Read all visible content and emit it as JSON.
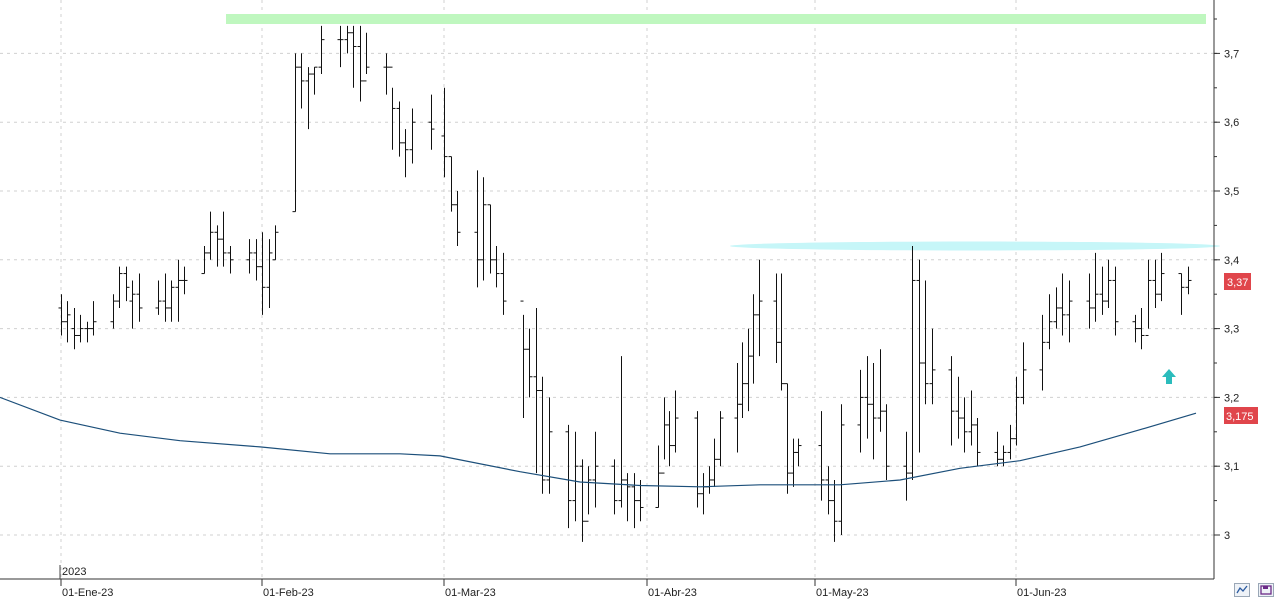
{
  "chart_data": {
    "type": "ohlc-bar",
    "year_label": "2023",
    "x_tick_labels": [
      "01-Ene-23",
      "01-Feb-23",
      "01-Mar-23",
      "01-Abr-23",
      "01-May-23",
      "01-Jun-23"
    ],
    "y_tick_labels": [
      "3,7",
      "3,6",
      "3,5",
      "3,4",
      "3,3",
      "3,2",
      "3,1",
      "3"
    ],
    "y_ticks": [
      3.7,
      3.6,
      3.5,
      3.4,
      3.3,
      3.2,
      3.1,
      3.0
    ],
    "ylim": [
      2.98,
      3.78
    ],
    "grid": true,
    "price_badge": {
      "label": "3,37",
      "value": 3.37,
      "color": "#e0454b"
    },
    "ma_badge": {
      "label": "3,175",
      "value": 3.175,
      "color": "#e0454b"
    },
    "ma_color": "#1c4f7a",
    "resistance_top": {
      "value": 3.745,
      "from": "2023-01-26",
      "to": "2023-06-30",
      "color": "#bff7bf"
    },
    "resistance_mid": {
      "value": 3.418,
      "from": "2023-04-04",
      "to": "2023-06-28",
      "color": "#c6f6f8"
    },
    "arrow_color": "#2bbcbc",
    "arrow_value": 3.235,
    "arrow_date": "2023-06-26",
    "series": [
      {
        "type": "ohlc",
        "points": [
          [
            "2023-01-01",
            3.33,
            3.35,
            3.29,
            3.31
          ],
          [
            "2023-01-02",
            3.31,
            3.34,
            3.28,
            3.32
          ],
          [
            "2023-01-03",
            3.3,
            3.33,
            3.27,
            3.29
          ],
          [
            "2023-01-04",
            3.29,
            3.32,
            3.28,
            3.3
          ],
          [
            "2023-01-05",
            3.3,
            3.31,
            3.28,
            3.3
          ],
          [
            "2023-01-06",
            3.3,
            3.34,
            3.29,
            3.31
          ],
          [
            "2023-01-09",
            3.31,
            3.35,
            3.3,
            3.34
          ],
          [
            "2023-01-10",
            3.34,
            3.39,
            3.33,
            3.38
          ],
          [
            "2023-01-11",
            3.38,
            3.39,
            3.34,
            3.36
          ],
          [
            "2023-01-12",
            3.34,
            3.37,
            3.3,
            3.35
          ],
          [
            "2023-01-13",
            3.35,
            3.38,
            3.31,
            3.33
          ],
          [
            "2023-01-16",
            3.33,
            3.37,
            3.32,
            3.34
          ],
          [
            "2023-01-17",
            3.34,
            3.38,
            3.31,
            3.33
          ],
          [
            "2023-01-18",
            3.33,
            3.37,
            3.31,
            3.36
          ],
          [
            "2023-01-19",
            3.36,
            3.4,
            3.31,
            3.37
          ],
          [
            "2023-01-20",
            3.37,
            3.39,
            3.35,
            3.37
          ],
          [
            "2023-01-23",
            3.38,
            3.42,
            3.38,
            3.41
          ],
          [
            "2023-01-24",
            3.41,
            3.47,
            3.4,
            3.44
          ],
          [
            "2023-01-25",
            3.44,
            3.45,
            3.39,
            3.43
          ],
          [
            "2023-01-26",
            3.43,
            3.47,
            3.39,
            3.41
          ],
          [
            "2023-01-27",
            3.41,
            3.42,
            3.38,
            3.4
          ],
          [
            "2023-01-30",
            3.4,
            3.43,
            3.38,
            3.41
          ],
          [
            "2023-01-31",
            3.41,
            3.43,
            3.37,
            3.39
          ],
          [
            "2023-02-01",
            3.39,
            3.44,
            3.32,
            3.36
          ],
          [
            "2023-02-02",
            3.36,
            3.43,
            3.33,
            3.41
          ],
          [
            "2023-02-03",
            3.4,
            3.45,
            3.4,
            3.44
          ],
          [
            "2023-02-06",
            3.47,
            3.7,
            3.47,
            3.68
          ],
          [
            "2023-02-07",
            3.68,
            3.7,
            3.62,
            3.66
          ],
          [
            "2023-02-08",
            3.66,
            3.68,
            3.59,
            3.67
          ],
          [
            "2023-02-09",
            3.67,
            3.68,
            3.64,
            3.68
          ],
          [
            "2023-02-10",
            3.68,
            3.74,
            3.67,
            3.72
          ],
          [
            "2023-02-13",
            3.72,
            3.74,
            3.68,
            3.72
          ],
          [
            "2023-02-14",
            3.72,
            3.74,
            3.7,
            3.73
          ],
          [
            "2023-02-15",
            3.73,
            3.74,
            3.65,
            3.71
          ],
          [
            "2023-02-16",
            3.71,
            3.74,
            3.63,
            3.66
          ],
          [
            "2023-02-17",
            3.66,
            3.73,
            3.67,
            3.68
          ],
          [
            "2023-02-20",
            3.68,
            3.7,
            3.64,
            3.68
          ],
          [
            "2023-02-21",
            3.68,
            3.65,
            3.56,
            3.62
          ],
          [
            "2023-02-22",
            3.62,
            3.63,
            3.55,
            3.57
          ],
          [
            "2023-02-23",
            3.57,
            3.59,
            3.52,
            3.56
          ],
          [
            "2023-02-24",
            3.56,
            3.62,
            3.54,
            3.6
          ],
          [
            "2023-02-27",
            3.6,
            3.64,
            3.56,
            3.59
          ]
        ]
      }
    ],
    "ma_points": [
      [
        0,
        3.2
      ],
      [
        60,
        3.167
      ],
      [
        120,
        3.148
      ],
      [
        180,
        3.137
      ],
      [
        260,
        3.128
      ],
      [
        330,
        3.118
      ],
      [
        400,
        3.118
      ],
      [
        440,
        3.115
      ],
      [
        520,
        3.092
      ],
      [
        580,
        3.077
      ],
      [
        640,
        3.072
      ],
      [
        700,
        3.07
      ],
      [
        760,
        3.073
      ],
      [
        840,
        3.073
      ],
      [
        900,
        3.08
      ],
      [
        960,
        3.097
      ],
      [
        1020,
        3.108
      ],
      [
        1080,
        3.128
      ],
      [
        1140,
        3.153
      ],
      [
        1196,
        3.177
      ]
    ]
  }
}
